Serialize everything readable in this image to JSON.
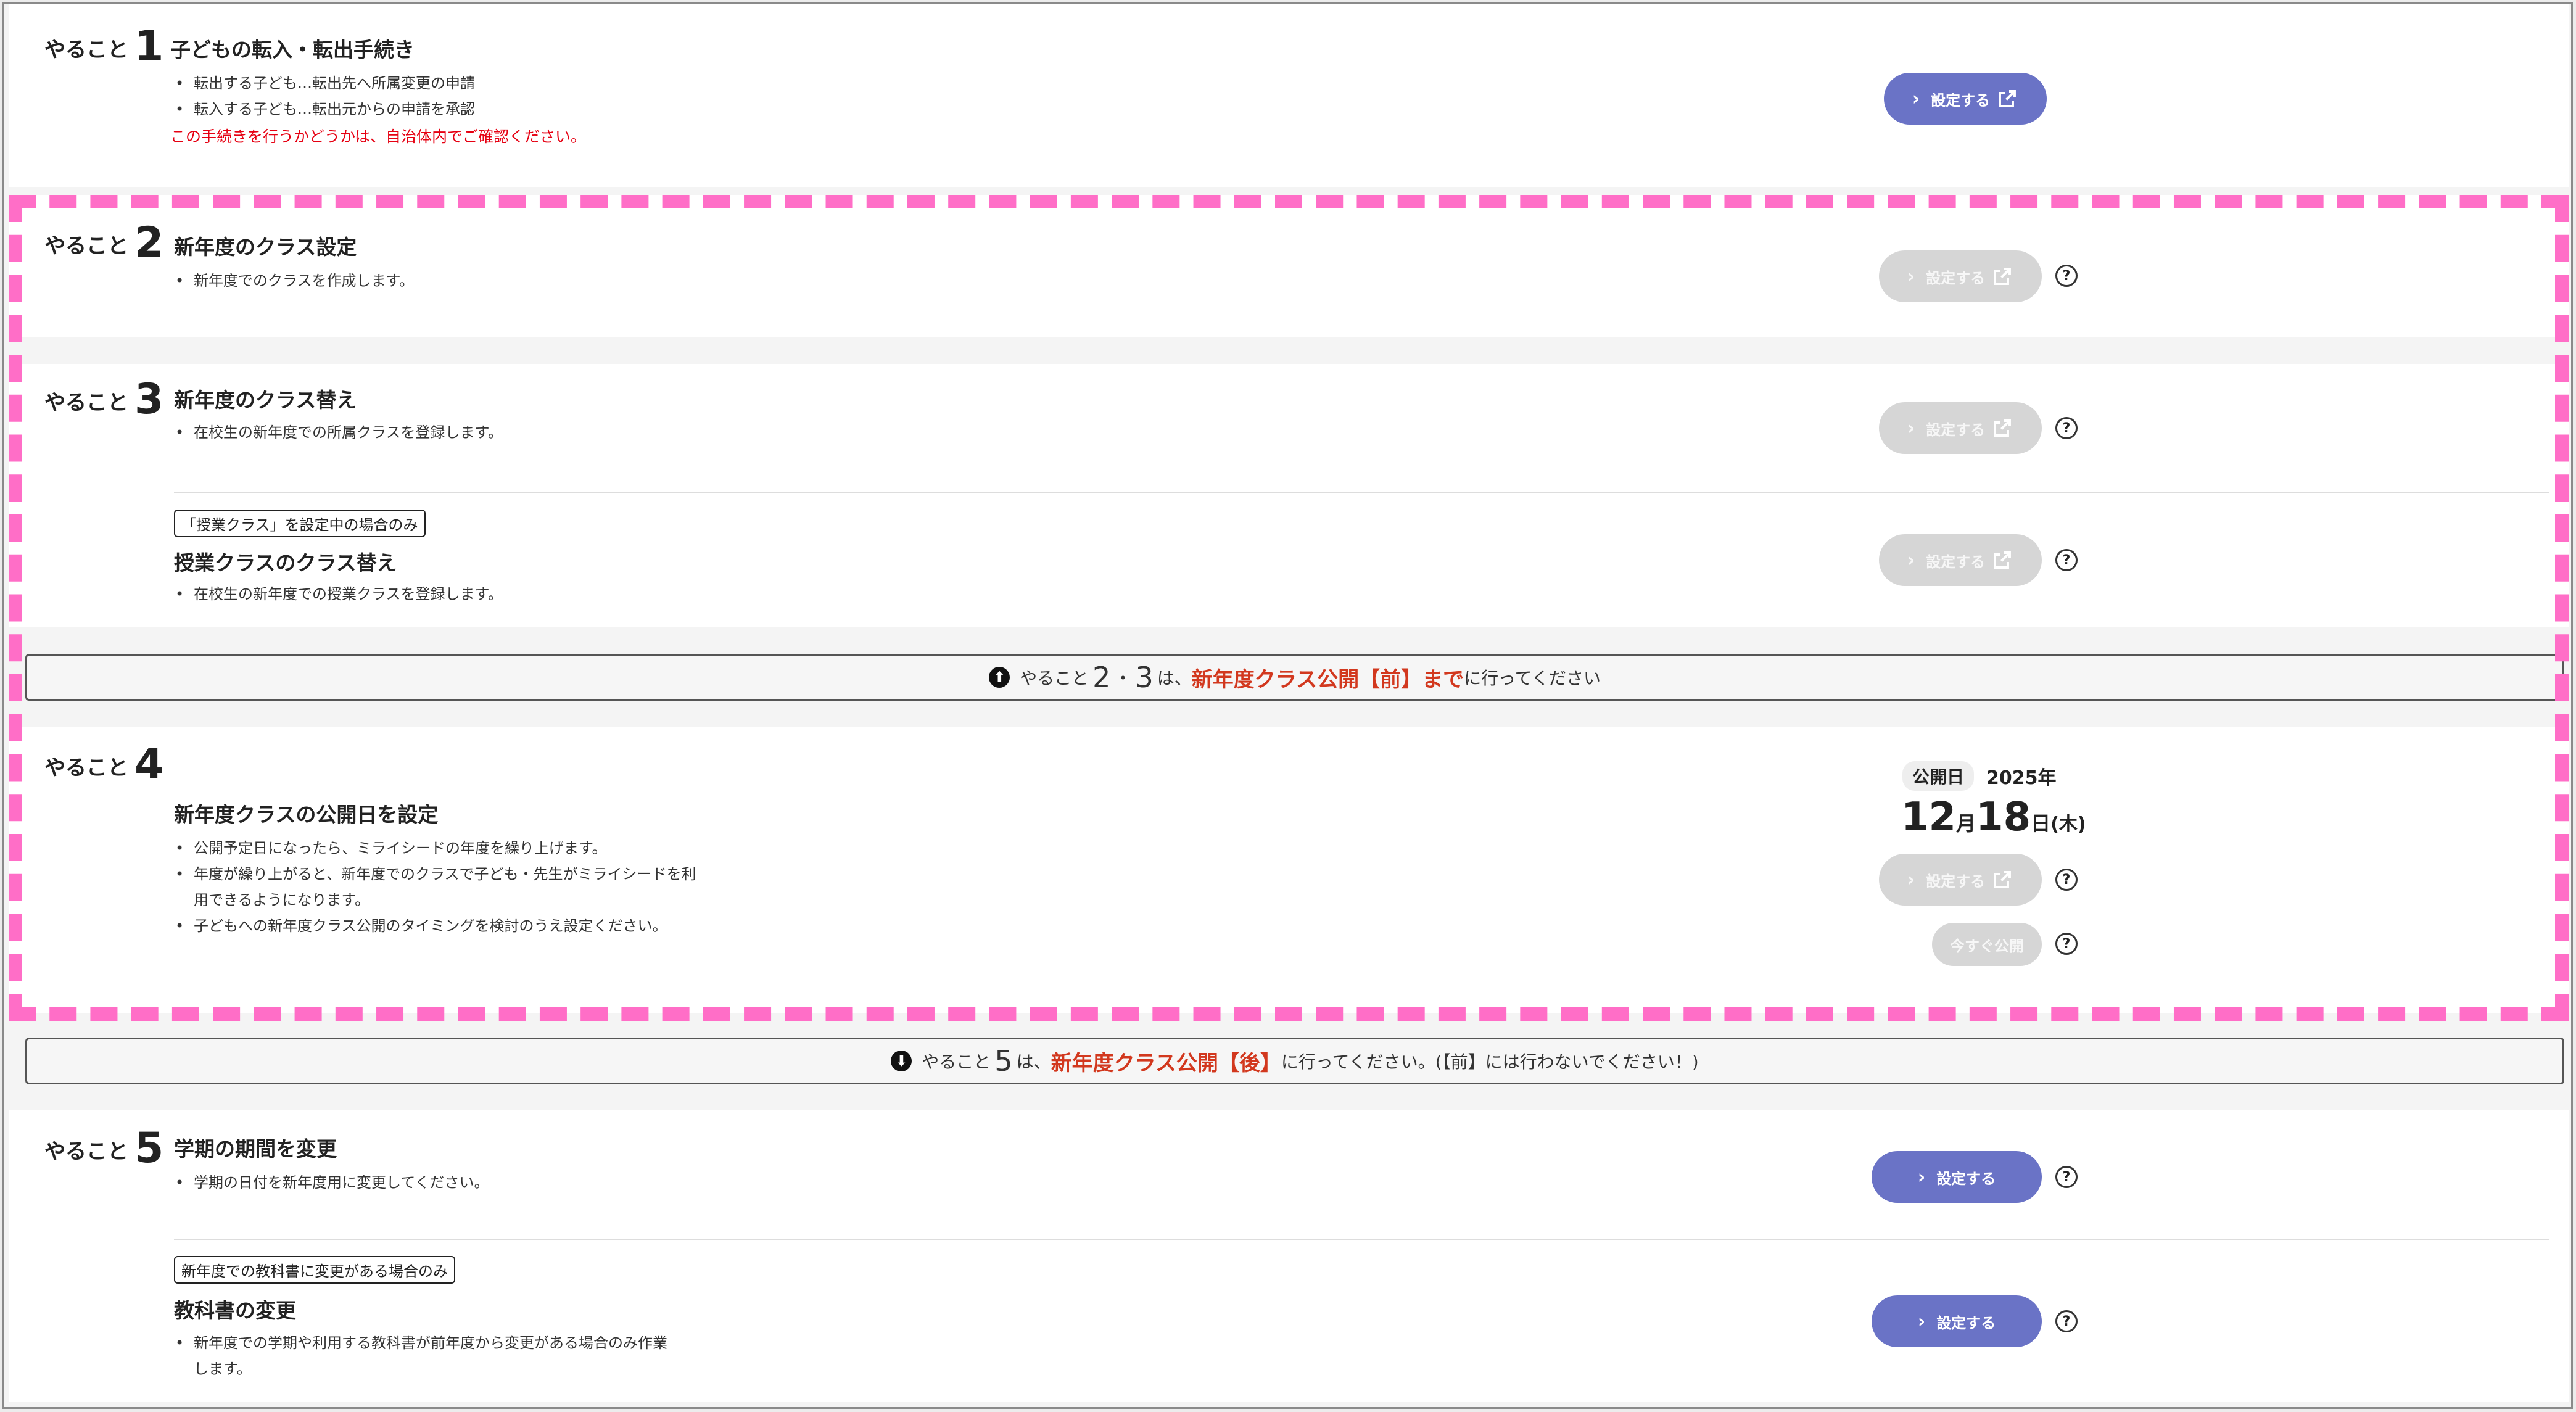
{
  "task_prefix": "やること",
  "button_label": "設定する",
  "help_symbol": "?",
  "colors": {
    "primary": "#6a73c6",
    "disabled": "#d6d6d6",
    "alert_red": "#e60012",
    "highlight_dash": "#ff6ec7"
  },
  "tasks": {
    "t1": {
      "num": "1",
      "title": "子どもの転入・転出手続き",
      "bullets": [
        "転出する子ども…転出先へ所属変更の申請",
        "転入する子ども…転出元からの申請を承認"
      ],
      "note": "この手続きを行うかどうかは、自治体内でご確認ください。"
    },
    "t2": {
      "num": "2",
      "title": "新年度のクラス設定",
      "bullets": [
        "新年度でのクラスを作成します。"
      ]
    },
    "t3": {
      "num": "3",
      "title": "新年度のクラス替え",
      "bullets": [
        "在校生の新年度での所属クラスを登録します。"
      ],
      "sub_tag": "「授業クラス」を設定中の場合のみ",
      "sub_title": "授業クラスのクラス替え",
      "sub_bullets": [
        "在校生の新年度での授業クラスを登録します。"
      ]
    },
    "t4": {
      "num": "4",
      "title": "新年度クラスの公開日を設定",
      "bullets": [
        "公開予定日になったら、ミライシードの年度を繰り上げます。",
        "年度が繰り上がると、新年度でのクラスで子ども・先生がミライシードを利",
        "用できるようになります。",
        "子どもへの新年度クラス公開のタイミングを検討のうえ設定ください。"
      ],
      "publish_label": "公開日",
      "year": "2025年",
      "month_num": "12",
      "month_unit": "月",
      "day_num": "18",
      "day_unit": "日",
      "weekday": "(木)",
      "publish_now": "今すぐ公開"
    },
    "t5": {
      "num": "5",
      "title": "学期の期間を変更",
      "bullets": [
        "学期の日付を新年度用に変更してください。"
      ],
      "sub_tag": "新年度での教科書に変更がある場合のみ",
      "sub_title": "教科書の変更",
      "sub_bullets": [
        "新年度での学期や利用する教科書が前年度から変更がある場合のみ作業",
        "します。"
      ]
    }
  },
  "notice_1": {
    "icon": "up-arrow-circle",
    "arrow": "⬆",
    "pre": "やること",
    "n1": "2",
    "sep": "・",
    "n2": "3",
    "wa": "は、",
    "red": "新年度クラス公開【前】まで",
    "post": "に行ってください"
  },
  "notice_2": {
    "icon": "down-arrow-circle",
    "arrow": "⬇",
    "pre": "やること",
    "n1": "5",
    "wa": "は、",
    "red": "新年度クラス公開【後】",
    "post": "に行ってください。(【前】には行わないでください！)"
  }
}
